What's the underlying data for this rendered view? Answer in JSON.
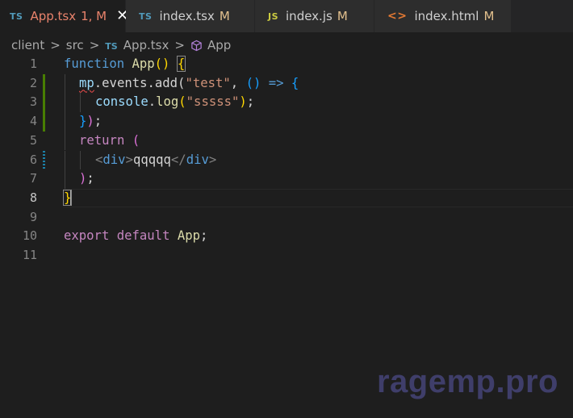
{
  "tabs": [
    {
      "icon": "TS",
      "label": "App.tsx",
      "status": "1, M"
    },
    {
      "icon": "TS",
      "label": "index.tsx",
      "status": "M"
    },
    {
      "icon": "JS",
      "label": "index.js",
      "status": "M"
    },
    {
      "icon": "<>",
      "label": "index.html",
      "status": "M"
    }
  ],
  "tab_close_glyph": "✕",
  "breadcrumb": {
    "folder1": "client",
    "folder2": "src",
    "file_icon": "TS",
    "file": "App.tsx",
    "symbol": "App",
    "separator": ">"
  },
  "lines": {
    "n1": "1",
    "n2": "2",
    "n3": "3",
    "n4": "4",
    "n5": "5",
    "n6": "6",
    "n7": "7",
    "n8": "8",
    "n9": "9",
    "n10": "10",
    "n11": "11"
  },
  "code": {
    "l1_kw": "function",
    "l1_name": "App",
    "l1_parens": "()",
    "l1_brace": "{",
    "l2_obj": "mp",
    "l2_rest": ".events.add(",
    "l2_str": "\"test\"",
    "l2_comma": ", ",
    "l2_parens": "()",
    "l2_arrow": " => ",
    "l2_brace": "{",
    "l3_obj": "console",
    "l3_dot": ".",
    "l3_fn": "log",
    "l3_open": "(",
    "l3_str": "\"sssss\"",
    "l3_close": ");",
    "l4_brace": "}",
    "l4_end": ");",
    "l5_kw": "return",
    "l5_paren": "(",
    "l6_open": "<",
    "l6_tag": "div",
    "l6_gt": ">",
    "l6_text": "qqqqq",
    "l6_close_lt": "</",
    "l6_close_tag": "div",
    "l6_close_gt": ">",
    "l7_paren": ")",
    "l7_semi": ";",
    "l8_brace": "}",
    "l10_kw1": "export",
    "l10_kw2": "default",
    "l10_name": "App",
    "l10_semi": ";"
  },
  "watermark": "ragemp.pro",
  "colors": {
    "editor_bg": "#1e1e1e",
    "active_tab_fg": "#e9836c",
    "modified_status": "#e2c08d",
    "gutter_added": "#487e02",
    "gutter_modified": "#1b81a8"
  }
}
